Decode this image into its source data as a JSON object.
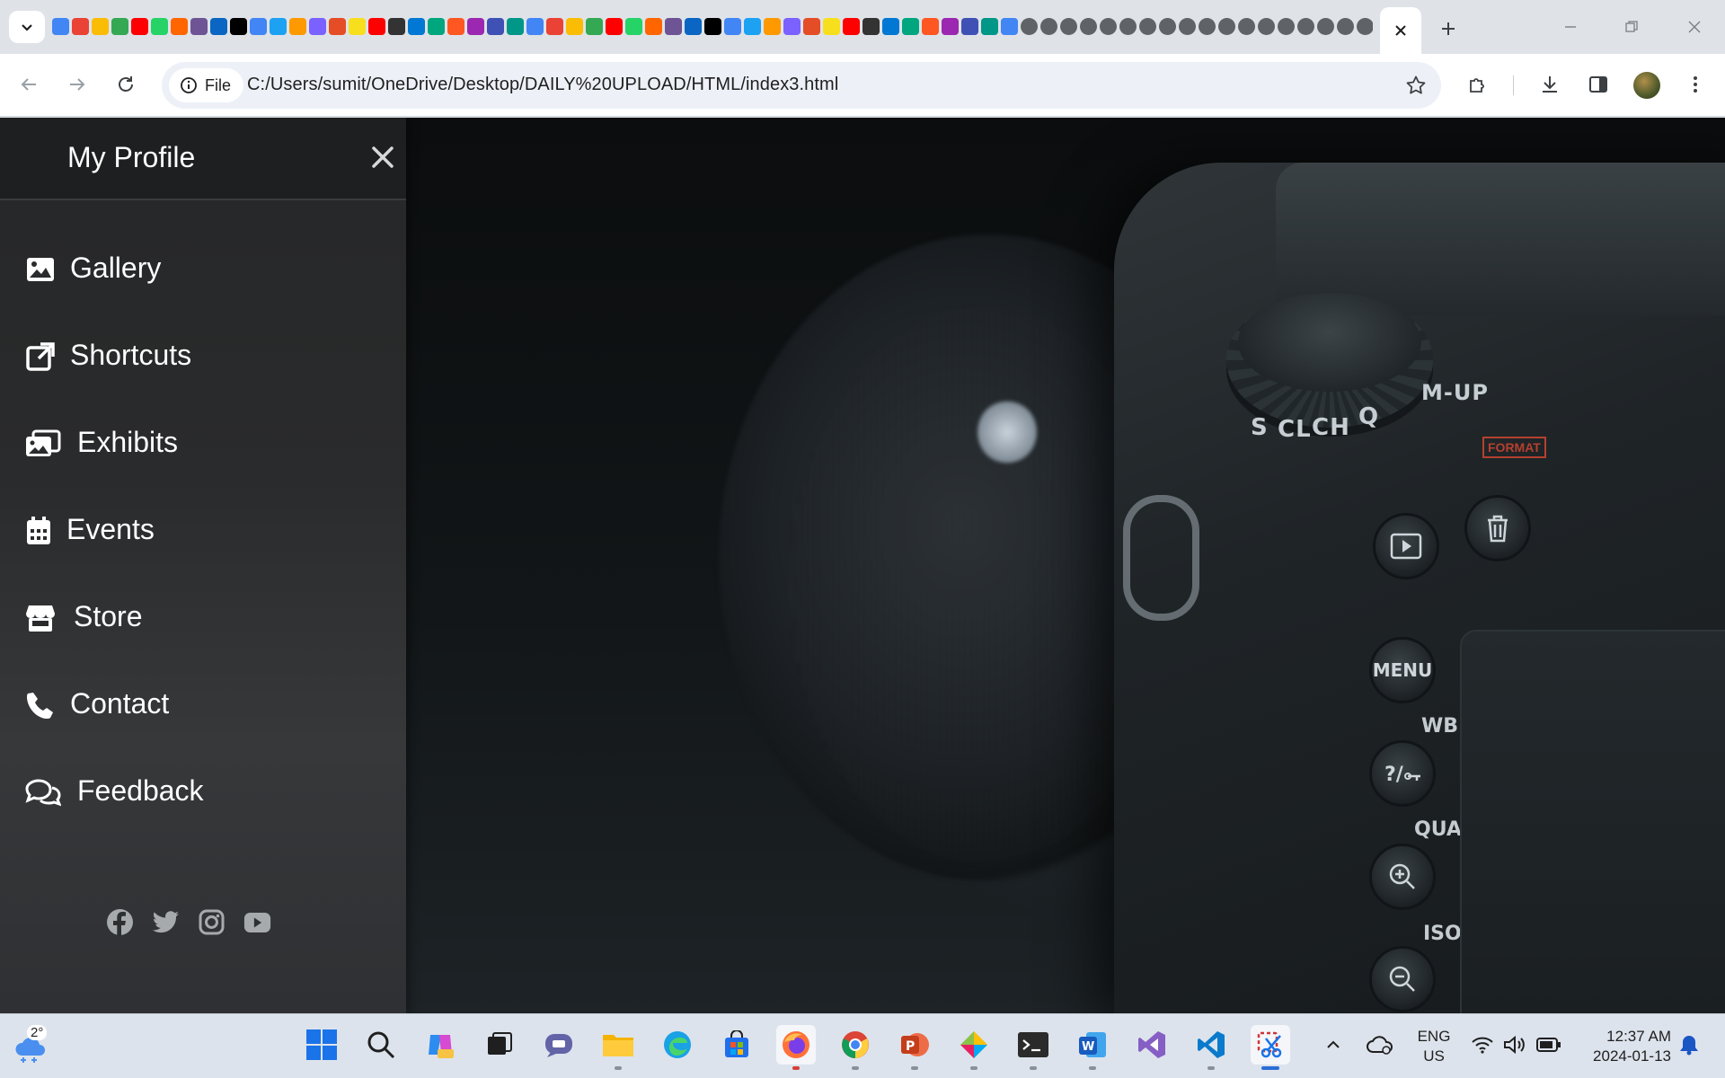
{
  "browser": {
    "address": {
      "chip_label": "File",
      "url": "C:/Users/sumit/OneDrive/Desktop/DAILY%20UPLOAD/HTML/index3.html"
    },
    "tab_favicon_colors": [
      "#4285f4",
      "#ea4335",
      "#fbbc05",
      "#34a853",
      "#ff0000",
      "#25d366",
      "#ff6600",
      "#6e5494",
      "#0a66c2",
      "#000000",
      "#4285f4",
      "#1da1f2",
      "#ff9900",
      "#7b61ff",
      "#e44d26",
      "#f7df1e",
      "#ff0000",
      "#333333",
      "#0078d4",
      "#00a67e",
      "#ff5722",
      "#9c27b0",
      "#3f51b5",
      "#009688"
    ],
    "active_tab_icon": "close-icon"
  },
  "sidebar": {
    "title": "My Profile",
    "items": [
      {
        "label": "Gallery",
        "icon": "image-icon"
      },
      {
        "label": "Shortcuts",
        "icon": "external-link-icon"
      },
      {
        "label": "Exhibits",
        "icon": "photo-stack-icon"
      },
      {
        "label": "Events",
        "icon": "calendar-icon"
      },
      {
        "label": "Store",
        "icon": "store-icon"
      },
      {
        "label": "Contact",
        "icon": "phone-icon"
      },
      {
        "label": "Feedback",
        "icon": "comments-icon"
      }
    ],
    "socials": [
      "facebook-icon",
      "twitter-icon",
      "instagram-icon",
      "youtube-icon"
    ]
  },
  "hero": {
    "dial_labels": [
      "S",
      "CL",
      "CH",
      "Q",
      "M-UP"
    ],
    "button_labels": [
      "MENU",
      "WB",
      "QUAL",
      "ISO"
    ],
    "format_label": "FORMAT"
  },
  "taskbar": {
    "weather_temp": "2°",
    "language": "ENG",
    "region": "US",
    "time": "12:37 AM",
    "date": "2024-01-13"
  }
}
